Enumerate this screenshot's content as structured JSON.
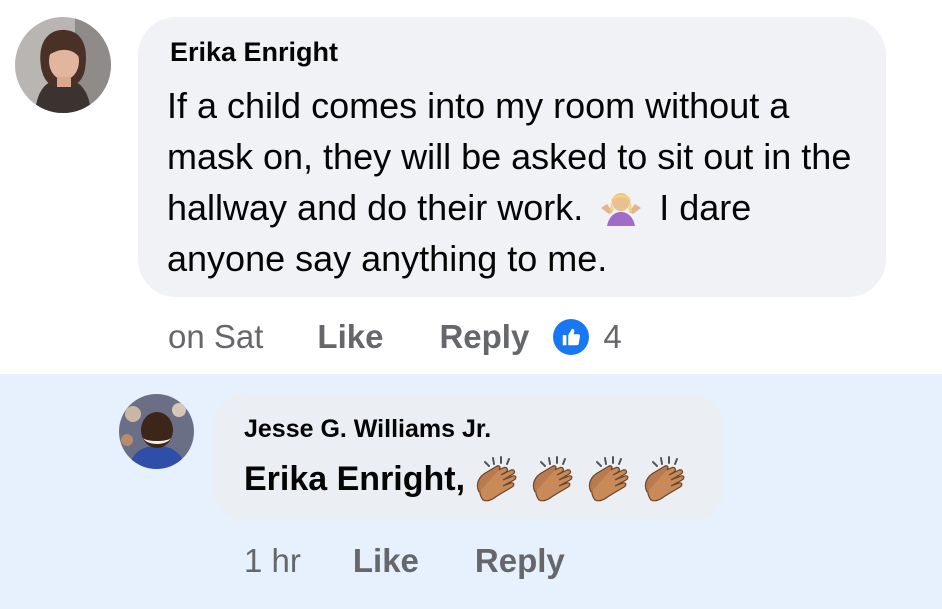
{
  "comment": {
    "author": "Erika Enright",
    "text_part1": "If a child comes into my room without a mask on, they will be asked to sit out in the hallway and do their work.",
    "emoji": "person-shrugging-emoji",
    "text_part2": "I dare anyone say anything to me.",
    "time": "on Sat",
    "like_label": "Like",
    "reply_label": "Reply",
    "reaction_icon": "like-icon",
    "reaction_count": "4"
  },
  "reply": {
    "author": "Jesse G. Williams Jr.",
    "text": "Erika Enright,",
    "emojis": [
      "clapping-hands-emoji",
      "clapping-hands-emoji",
      "clapping-hands-emoji",
      "clapping-hands-emoji"
    ],
    "time": "1 hr",
    "like_label": "Like",
    "reply_label": "Reply"
  },
  "colors": {
    "bubble": "#f0f2f5",
    "reply_highlight": "#e7f0fd",
    "meta_text": "#65676b",
    "like_blue": "#1877f2"
  }
}
